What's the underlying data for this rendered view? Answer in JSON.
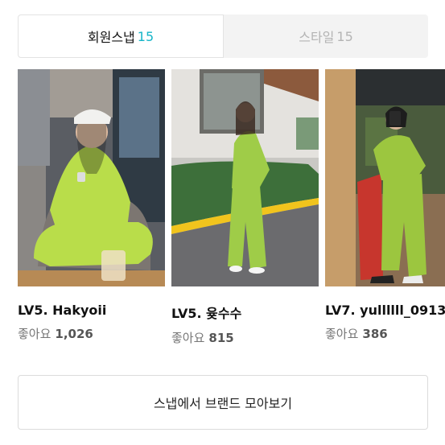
{
  "tabs": [
    {
      "label": "회원스냅",
      "count": "15",
      "active": true
    },
    {
      "label": "스타일",
      "count": "15",
      "active": false
    }
  ],
  "cards": [
    {
      "level": "LV5. Hakyoii",
      "likes_label": "좋아요",
      "likes": "1,026",
      "outfit_color": "#b9dd4a"
    },
    {
      "level": "LV5. 윶수수",
      "likes_label": "좋아요",
      "likes": "815",
      "outfit_color": "#9fcc48"
    },
    {
      "level": "LV7. yullllll_0913",
      "likes_label": "좋아요",
      "likes": "386",
      "outfit_color": "#9cc63f"
    }
  ],
  "more_button": {
    "label": "스냅에서 브랜드 모아보기"
  }
}
